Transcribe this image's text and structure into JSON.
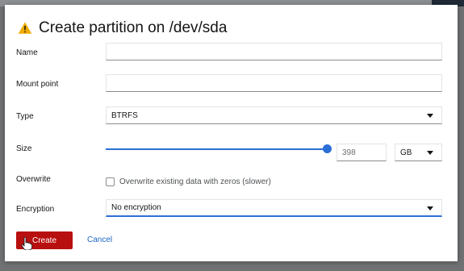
{
  "dialog": {
    "title": "Create partition on /dev/sda",
    "fields": {
      "name": {
        "label": "Name",
        "value": ""
      },
      "mount_point": {
        "label": "Mount point",
        "value": ""
      },
      "type": {
        "label": "Type",
        "value": "BTRFS"
      },
      "size": {
        "label": "Size",
        "value": "398",
        "unit": "GB",
        "slider_fraction": 0.98
      },
      "overwrite": {
        "label": "Overwrite",
        "checkbox_label": "Overwrite existing data with zeros (slower)",
        "checked": false
      },
      "encryption": {
        "label": "Encryption",
        "value": "No encryption"
      }
    },
    "buttons": {
      "create": "Create",
      "cancel": "Cancel"
    }
  },
  "colors": {
    "accent": "#2b6fd6",
    "danger": "#b80f0f",
    "warning": "#f0ab00",
    "link": "#1e66c5"
  },
  "icons": {
    "header": "warning-triangle-icon",
    "dropdown": "caret-down-icon",
    "cursor": "hand-pointer-icon"
  }
}
